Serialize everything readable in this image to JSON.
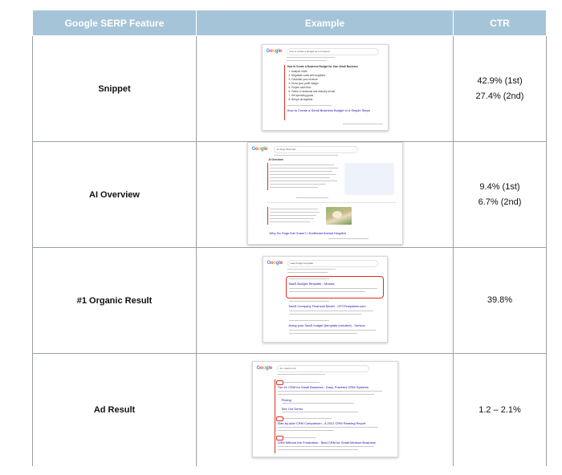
{
  "table": {
    "headers": [
      "Google SERP Feature",
      "Example",
      "CTR"
    ],
    "rows": [
      {
        "feature": "Snippet",
        "ctr": [
          "42.9% (1st)",
          "27.4% (2nd)"
        ],
        "example": {
          "search_text": "how to create a budget for a company",
          "heading": "How to Create a Business Budget for Your Small Business",
          "list": [
            "1. Analyze costs",
            "2. Negotiate costs with suppliers",
            "3. Calculate your revenue",
            "4. Know your profit margin",
            "5. Project cash flow",
            "6. Factor in seasonal and industry trends",
            "7. Set spending goals",
            "8. Bring it all together"
          ],
          "link": "How to Create a Small Business Budget in 8 Simple Steps"
        }
      },
      {
        "feature": "AI Overview",
        "ctr": [
          "9.4% (1st)",
          "6.7% (2nd)"
        ],
        "example": {
          "search_text": "do dogs hibernate",
          "label": "AI Overview",
          "link": "Why Do Dogs Eat Grass? | Northeast Animal Hospital"
        }
      },
      {
        "feature": "#1 Organic Result",
        "ctr": [
          "39.8%"
        ],
        "example": {
          "search_text": "saas budget template",
          "results": [
            "SaaS Budget Template - Mosaic",
            "SaaS Company Financial Model - CFOTemplates.com",
            "Acing your SaaS budget (template included) - Sonicor"
          ]
        }
      },
      {
        "feature": "Ad Result",
        "ctr": [
          "1.2 – 2.1%"
        ],
        "example": {
          "search_text": "do i need a crm",
          "results": [
            "The #1 CRM for Small Business - Easy, Powerful CRM Systems",
            "Pricing",
            "See Our Demo",
            "Side-by-side CRM Comparison - A 2021 CRM Ranking Report",
            "CRM Without the Frustration - Best CRM for Small-Medium Business"
          ]
        }
      }
    ]
  },
  "google_logo": [
    "G",
    "o",
    "o",
    "g",
    "l",
    "e"
  ]
}
